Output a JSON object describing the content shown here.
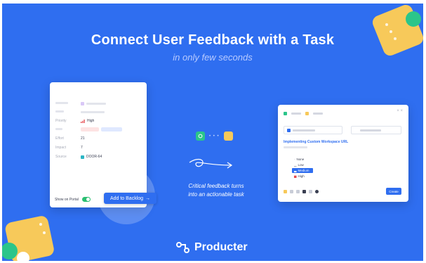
{
  "hero": {
    "headline": "Connect User Feedback with a Task",
    "subheadline": "in only few seconds"
  },
  "feedback_card": {
    "properties": [
      {
        "label": "Priority",
        "value": "High",
        "icon": "high-priority-icon"
      },
      {
        "label": "Effort",
        "value": "21"
      },
      {
        "label": "Impact",
        "value": "7"
      },
      {
        "label": "Source",
        "value": "DOOR-64"
      }
    ],
    "public_toggle_label": "Show on Portal",
    "public_toggle_on": true,
    "add_to_backlog_label": "Add to Backlog",
    "add_to_backlog_icon": "arrow-right-icon"
  },
  "middle": {
    "caption_line1": "Critical feedback turns",
    "caption_line2": "into an actionable task"
  },
  "task_card": {
    "task_title": "Implementing Custom Workspace URL",
    "priority_options": [
      {
        "label": "None",
        "selected": false
      },
      {
        "label": "Low",
        "selected": false
      },
      {
        "label": "Medium",
        "selected": true
      },
      {
        "label": "High",
        "selected": false
      }
    ],
    "create_label": "Create"
  },
  "brand": {
    "name": "Producter",
    "logo_icon": "producter-logo-icon"
  },
  "colors": {
    "background": "#2f6ef0",
    "accent_green": "#2bc58a",
    "accent_yellow": "#f7c95a",
    "priority_red": "#e5484d"
  }
}
